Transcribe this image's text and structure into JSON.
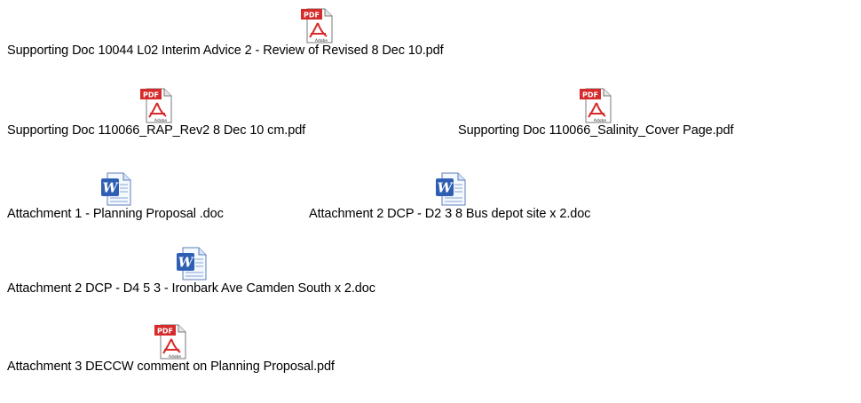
{
  "files": [
    {
      "name": "Supporting Doc 10044 L02 Interim Advice 2 - Review of Revised  8 Dec 10.pdf",
      "type": "pdf",
      "icon": "pdf-file-icon"
    },
    {
      "name": "Supporting Doc 110066_RAP_Rev2  8 Dec 10 cm.pdf",
      "type": "pdf",
      "icon": "pdf-file-icon"
    },
    {
      "name": "Supporting Doc 110066_Salinity_Cover Page.pdf",
      "type": "pdf",
      "icon": "pdf-file-icon"
    },
    {
      "name": "Attachment 1 - Planning Proposal .doc",
      "type": "doc",
      "icon": "word-file-icon"
    },
    {
      "name": "Attachment 2 DCP - D2 3 8 Bus depot site x 2.doc",
      "type": "doc",
      "icon": "word-file-icon"
    },
    {
      "name": "Attachment 2 DCP - D4 5 3 - Ironbark Ave Camden South x 2.doc",
      "type": "doc",
      "icon": "word-file-icon"
    },
    {
      "name": "Attachment 3 DECCW comment on Planning Proposal.pdf",
      "type": "pdf",
      "icon": "pdf-file-icon"
    }
  ],
  "colors": {
    "pdf_badge": "#d62b2b",
    "word_blue": "#2f5fb3",
    "page_bg": "#ffffff"
  },
  "icon_text": {
    "pdf_badge": "PDF",
    "word_letter": "W",
    "adobe_label": "Adobe"
  }
}
